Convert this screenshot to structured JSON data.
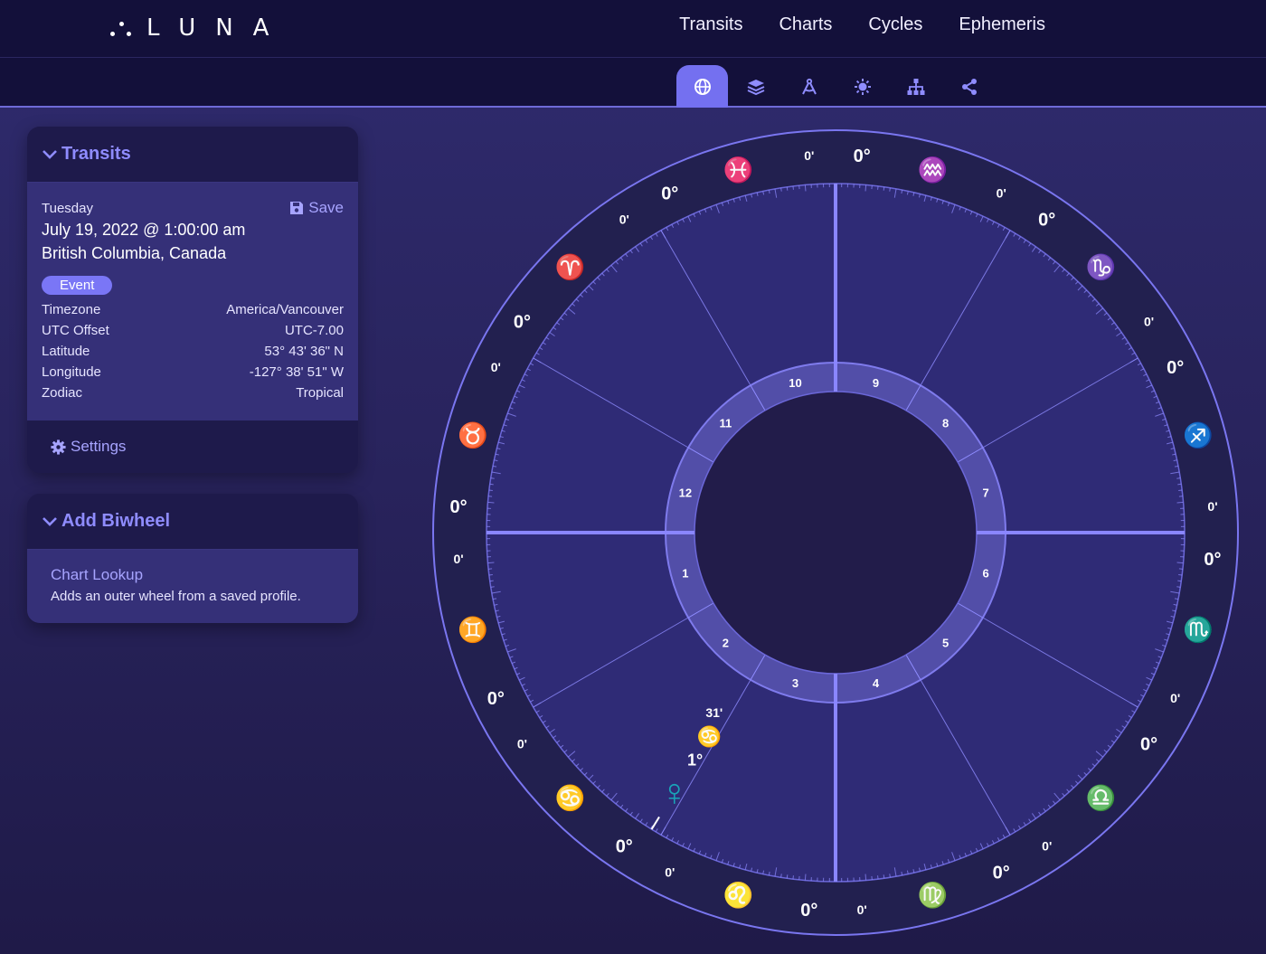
{
  "app": {
    "logo_text": "LUNA"
  },
  "nav": {
    "items": [
      "Transits",
      "Charts",
      "Cycles",
      "Ephemeris"
    ]
  },
  "toolbar": {
    "icons": [
      "globe-icon",
      "layers-icon",
      "compass-icon",
      "sun-icon",
      "hierarchy-icon",
      "share-icon"
    ],
    "active": "globe-icon"
  },
  "transits_card": {
    "title": "Transits",
    "day": "Tuesday",
    "datetime": "July 19, 2022 @ 1:00:00 am",
    "location": "British Columbia, Canada",
    "save_label": "Save",
    "badge": "Event",
    "details": [
      {
        "label": "Timezone",
        "value": "America/Vancouver"
      },
      {
        "label": "UTC Offset",
        "value": "UTC-7.00"
      },
      {
        "label": "Latitude",
        "value": "53° 43' 36\" N"
      },
      {
        "label": "Longitude",
        "value": "-127° 38' 51\" W"
      },
      {
        "label": "Zodiac",
        "value": "Tropical"
      }
    ],
    "settings_label": "Settings"
  },
  "biwheel_card": {
    "title": "Add Biwheel",
    "link": "Chart Lookup",
    "description": "Adds an outer wheel from a saved profile."
  },
  "chart": {
    "signs": [
      {
        "name": "aquarius",
        "glyph": "♒",
        "deg": "0°",
        "min": "0'",
        "color": "#19b3b3"
      },
      {
        "name": "capricorn",
        "glyph": "♑",
        "deg": "0°",
        "min": "0'",
        "color": "#c3408f"
      },
      {
        "name": "sagittarius",
        "glyph": "♐",
        "deg": "0°",
        "min": "0'",
        "color": "#e23a8e"
      },
      {
        "name": "scorpio",
        "glyph": "♏",
        "deg": "0°",
        "min": "0'",
        "color": "#5b58ee"
      },
      {
        "name": "libra",
        "glyph": "♎",
        "deg": "0°",
        "min": "0'",
        "color": "#19b3b3"
      },
      {
        "name": "virgo",
        "glyph": "♍",
        "deg": "0°",
        "min": "0'",
        "color": "#c3408f"
      },
      {
        "name": "leo",
        "glyph": "♌",
        "deg": "0°",
        "min": "0'",
        "color": "#e23a8e"
      },
      {
        "name": "cancer",
        "glyph": "♋",
        "deg": "0°",
        "min": "0'",
        "color": "#5b58ee"
      },
      {
        "name": "gemini",
        "glyph": "♊",
        "deg": "0°",
        "min": "0'",
        "color": "#19b3b3"
      },
      {
        "name": "taurus",
        "glyph": "♉",
        "deg": "0°",
        "min": "0'",
        "color": "#c3408f"
      },
      {
        "name": "aries",
        "glyph": "♈",
        "deg": "0°",
        "min": "0'",
        "color": "#e23a8e"
      },
      {
        "name": "pisces",
        "glyph": "♓",
        "deg": "0°",
        "min": "0'",
        "color": "#5b58ee"
      }
    ],
    "houses": [
      "1",
      "2",
      "3",
      "4",
      "5",
      "6",
      "7",
      "8",
      "9",
      "10",
      "11",
      "12"
    ],
    "planet": {
      "name": "venus",
      "glyph": "♀",
      "sign_glyph": "♋",
      "deg": "1°",
      "min": "31'",
      "color": "#19a4b8",
      "sign_color": "#5b58ee"
    }
  }
}
